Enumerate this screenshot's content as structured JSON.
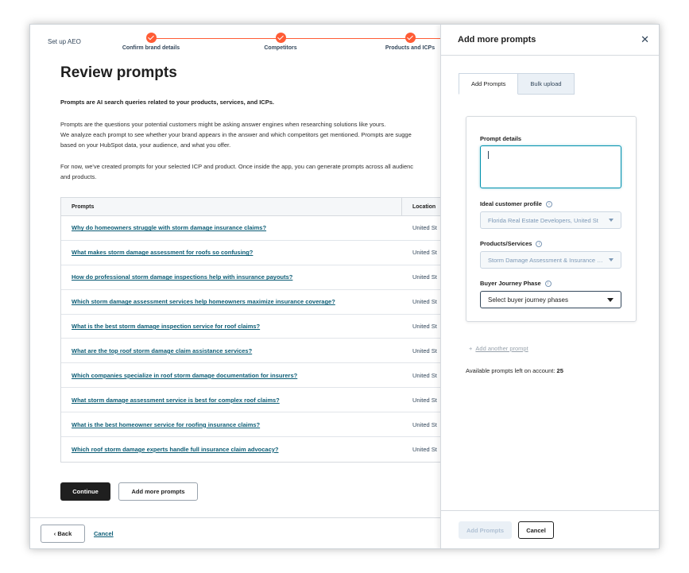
{
  "header": {
    "setup_label": "Set up AEO",
    "steps": [
      {
        "label": "Confirm brand details"
      },
      {
        "label": "Competitors"
      },
      {
        "label": "Products and ICPs"
      }
    ]
  },
  "main": {
    "title": "Review prompts",
    "intro_bold": "Prompts are AI search queries related to your products, services, and ICPs.",
    "para1_line1": "Prompts are the questions your potential customers might be asking answer engines when researching solutions like yours.",
    "para1_line2": "We analyze each prompt to see whether your brand appears in the answer and which competitors get mentioned. Prompts are sugge",
    "para1_line3": "based on your HubSpot data, your audience, and what you offer.",
    "para2_line1": "For now, we've created prompts for your selected ICP and product. Once inside the app, you can generate prompts across all audienc",
    "para2_line2": "and products."
  },
  "table": {
    "headers": {
      "prompt": "Prompts",
      "location": "Location"
    },
    "rows": [
      {
        "prompt": "Why do homeowners struggle with storm damage insurance claims?",
        "location": "United St"
      },
      {
        "prompt": "What makes storm damage assessment for roofs so confusing?",
        "location": "United St"
      },
      {
        "prompt": "How do professional storm damage inspections help with insurance payouts?",
        "location": "United St"
      },
      {
        "prompt": "Which storm damage assessment services help homeowners maximize insurance coverage?",
        "location": "United St"
      },
      {
        "prompt": "What is the best storm damage inspection service for roof claims?",
        "location": "United St"
      },
      {
        "prompt": "What are the top roof storm damage claim assistance services?",
        "location": "United St"
      },
      {
        "prompt": "Which companies specialize in roof storm damage documentation for insurers?",
        "location": "United St"
      },
      {
        "prompt": "What storm damage assessment service is best for complex roof claims?",
        "location": "United St"
      },
      {
        "prompt": "What is the best homeowner service for roofing insurance claims?",
        "location": "United St"
      },
      {
        "prompt": "Which roof storm damage experts handle full insurance claim advocacy?",
        "location": "United St"
      }
    ]
  },
  "actions": {
    "continue_label": "Continue",
    "add_more_label": "Add more prompts",
    "back_label": "Back",
    "back_icon": "‹",
    "cancel_label": "Cancel"
  },
  "panel": {
    "title": "Add more prompts",
    "close_icon": "✕",
    "tabs": [
      {
        "label": "Add Prompts"
      },
      {
        "label": "Bulk upload"
      }
    ],
    "fields": {
      "prompt_details_label": "Prompt details",
      "prompt_details_value": "",
      "icp_label": "Ideal customer profile",
      "icp_value": "Florida Real Estate Developers, United St",
      "products_label": "Products/Services",
      "products_value": "Storm Damage Assessment & Insurance Claims",
      "journey_label": "Buyer Journey Phase",
      "journey_value": "Select buyer journey phases",
      "info_icon": "i"
    },
    "add_another_icon": "+",
    "add_another_label": "Add another prompt",
    "available_label": "Available prompts left on account:",
    "available_count": "25",
    "add_prompts_label": "Add Prompts",
    "cancel_label": "Cancel"
  },
  "colors": {
    "accent": "#ff5c35",
    "link": "#0b5c75",
    "focus": "#0091ae"
  }
}
